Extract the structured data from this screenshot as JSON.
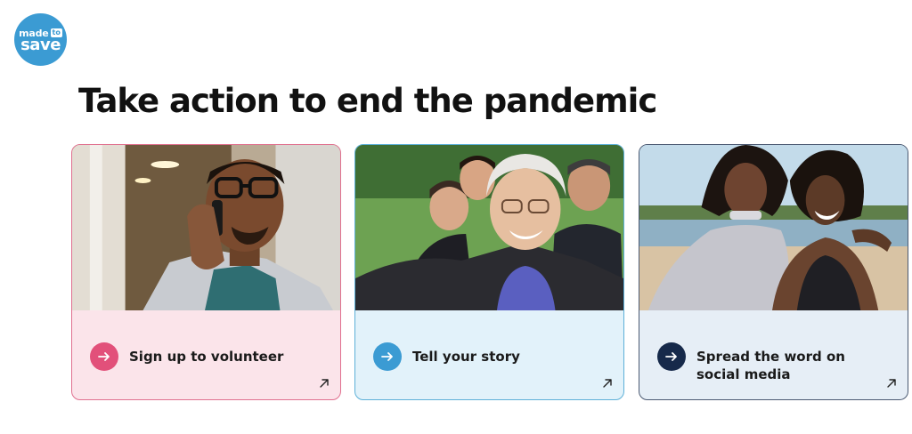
{
  "logo": {
    "made": "made",
    "to": "to",
    "save": "save"
  },
  "page_title": "Take action to end the pandemic",
  "cards": [
    {
      "label": "Sign up to volunteer",
      "arrow_icon": "arrow-right-icon",
      "external_icon": "arrow-up-right-icon",
      "accent": "#e2507a"
    },
    {
      "label": "Tell your story",
      "arrow_icon": "arrow-right-icon",
      "external_icon": "arrow-up-right-icon",
      "accent": "#3b9bd3"
    },
    {
      "label": "Spread the word on social media",
      "arrow_icon": "arrow-right-icon",
      "external_icon": "arrow-up-right-icon",
      "accent": "#16294a"
    }
  ]
}
